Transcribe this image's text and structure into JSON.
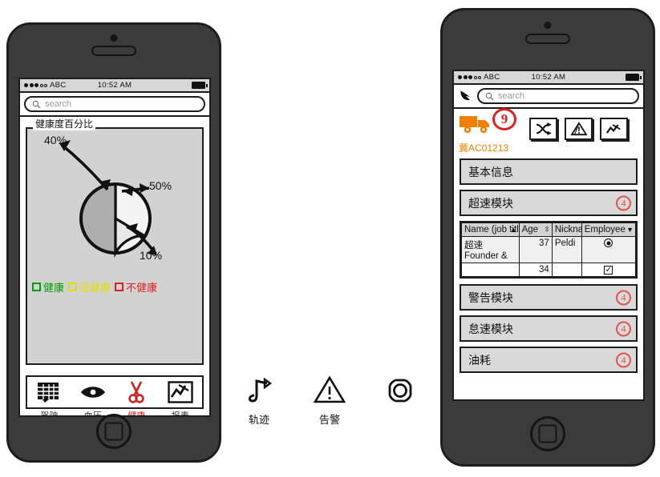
{
  "statusbar": {
    "carrier": "ABC",
    "time": "10:52 AM",
    "signal_filled": 3,
    "signal_empty": 2
  },
  "search": {
    "placeholder": "search",
    "icon": "search-icon"
  },
  "left_phone": {
    "card_title": "健康度百分比",
    "chart_data": {
      "type": "pie",
      "title": "健康度百分比",
      "categories": [
        "健康",
        "亚健康",
        "不健康"
      ],
      "values": [
        50,
        40,
        10
      ],
      "labels": [
        "50%",
        "40%",
        "10%"
      ],
      "colors": [
        "#f2f2f2",
        "#a8a8a8",
        "#e4e4e4"
      ],
      "legend": [
        {
          "label": "健康",
          "color": "#00a000"
        },
        {
          "label": "亚健康",
          "color": "#e8e800"
        },
        {
          "label": "不健康",
          "color": "#e02020"
        }
      ],
      "legend_position": "bottom",
      "annotations": [
        "40%",
        "50%",
        "10%"
      ]
    },
    "tabs": [
      {
        "label": "驾驶",
        "icon": "calendar-icon",
        "active": false
      },
      {
        "label": "血压",
        "icon": "eye-icon",
        "active": false
      },
      {
        "label": "健康",
        "icon": "scissors-icon",
        "active": true
      },
      {
        "label": "报表",
        "icon": "chart-icon",
        "active": false
      }
    ]
  },
  "right_phone": {
    "back_icon": "back-arrow-icon",
    "vehicle": {
      "icon": "truck-icon",
      "plate": "冀AC01213",
      "annotation": "9"
    },
    "header_icons": [
      {
        "name": "route-icon"
      },
      {
        "name": "warning-icon"
      },
      {
        "name": "chart-icon"
      }
    ],
    "rows_top": [
      {
        "label": "基本信息",
        "badge": ""
      },
      {
        "label": "超速模块",
        "badge": "4"
      }
    ],
    "table": {
      "columns": [
        {
          "header": "Name (job title)",
          "sort": "▲"
        },
        {
          "header": "Age",
          "sort": "⇳"
        },
        {
          "header": "Nickname",
          "sort": ""
        },
        {
          "header": "Employee",
          "sort": "▼"
        }
      ],
      "rows": [
        {
          "name_line1": "超速",
          "name_line2": "Founder &",
          "age": "37",
          "nick": "Peldi",
          "employee": "radio"
        },
        {
          "name_line1": "",
          "name_line2": "",
          "age": "34",
          "nick": "",
          "employee": "checkbox"
        }
      ]
    },
    "rows_bottom": [
      {
        "label": "警告模块",
        "badge": "4"
      },
      {
        "label": "怠速模块",
        "badge": "4"
      },
      {
        "label": "油耗",
        "badge": "4"
      }
    ]
  },
  "middle_icons": [
    {
      "label": "轨迹",
      "icon": "route-note-icon"
    },
    {
      "label": "告警",
      "icon": "warning-triangle-icon"
    },
    {
      "label": "",
      "icon": "gear-icon"
    }
  ]
}
